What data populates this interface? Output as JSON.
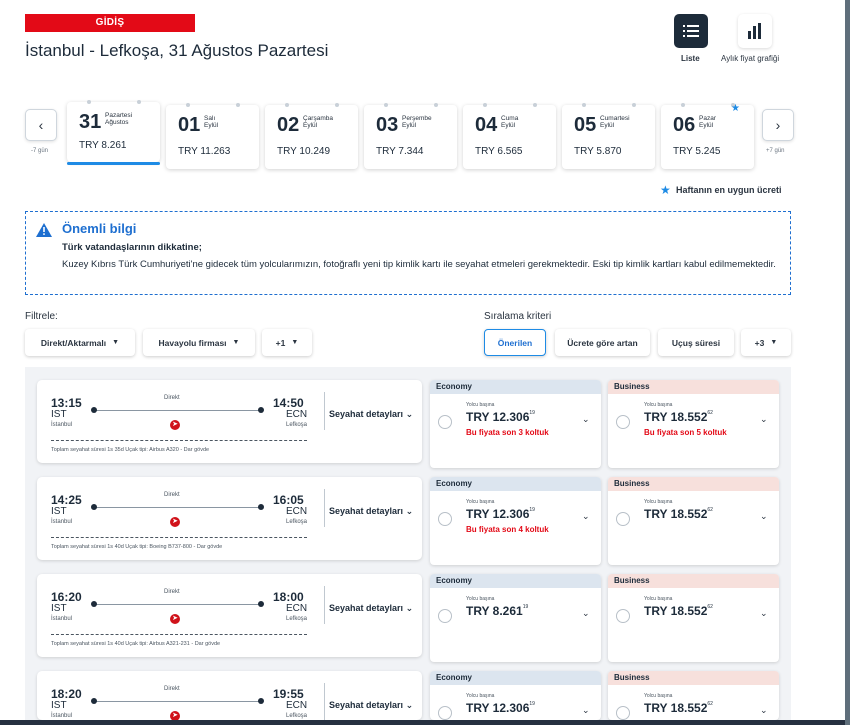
{
  "header": {
    "badge": "GİDİŞ",
    "route": "İstanbul - Lefkoşa, 31 Ağustos Pazartesi"
  },
  "views": {
    "list": "Liste",
    "chart": "Aylık fiyat grafiği"
  },
  "datebar": {
    "prev_label": "-7 gün",
    "next_label": "+7 gün",
    "prev_icon": "chevron-left-icon",
    "next_icon": "chevron-right-icon",
    "dates": [
      {
        "day": "31",
        "weekday": "Pazartesi",
        "month": "Ağustos",
        "price": "TRY 8.261"
      },
      {
        "day": "01",
        "weekday": "Salı",
        "month": "Eylül",
        "price": "TRY 11.263"
      },
      {
        "day": "02",
        "weekday": "Çarşamba",
        "month": "Eylül",
        "price": "TRY 10.249"
      },
      {
        "day": "03",
        "weekday": "Perşembe",
        "month": "Eylül",
        "price": "TRY 7.344"
      },
      {
        "day": "04",
        "weekday": "Cuma",
        "month": "Eylül",
        "price": "TRY 6.565"
      },
      {
        "day": "05",
        "weekday": "Cumartesi",
        "month": "Eylül",
        "price": "TRY 5.870"
      },
      {
        "day": "06",
        "weekday": "Pazar",
        "month": "Eylül",
        "price": "TRY 5.245"
      }
    ],
    "best_note": "Haftanın en uygun ücreti"
  },
  "info": {
    "title": "Önemli bilgi",
    "line1": "Türk vatandaşlarının dikkatine;",
    "line2": "Kuzey Kıbrıs Türk Cumhuriyeti'ne gidecek tüm yolcularımızın, fotoğraflı yeni tip kimlik kartı ile seyahat etmeleri gerekmektedir. Eski tip kimlik kartları kabul edilmemektedir."
  },
  "filters": {
    "label": "Filtrele:",
    "f1": "Direkt/Aktarmalı",
    "f2": "Havayolu firması",
    "f3": "+1"
  },
  "sort": {
    "label": "Sıralama kriteri",
    "s1": "Önerilen",
    "s2": "Ücrete göre artan",
    "s3": "Uçuş süresi",
    "s4": "+3"
  },
  "common": {
    "direct": "Direkt",
    "details": "Seyahat detayları",
    "per_pax": "Yolcu başına",
    "economy": "Economy",
    "business": "Business"
  },
  "flights": [
    {
      "dep": "13:15",
      "arr": "14:50",
      "from": "IST",
      "to": "ECN",
      "from_city": "İstanbul",
      "to_city": "Lefkoşa",
      "meta": "Toplam seyahat süresi 1s 35d  Uçak tipi: Airbus A320 - Dar gövde",
      "eco_int": "TRY 12.306",
      "eco_dec": "19",
      "eco_warn": "Bu fiyata son 3 koltuk",
      "bus_int": "TRY 18.552",
      "bus_dec": "62",
      "bus_warn": "Bu fiyata son 5 koltuk"
    },
    {
      "dep": "14:25",
      "arr": "16:05",
      "from": "IST",
      "to": "ECN",
      "from_city": "İstanbul",
      "to_city": "Lefkoşa",
      "meta": "Toplam seyahat süresi 1s 40d  Uçak tipi: Boeing B737-800 - Dar gövde",
      "eco_int": "TRY 12.306",
      "eco_dec": "19",
      "eco_warn": "Bu fiyata son 4 koltuk",
      "bus_int": "TRY 18.552",
      "bus_dec": "62",
      "bus_warn": ""
    },
    {
      "dep": "16:20",
      "arr": "18:00",
      "from": "IST",
      "to": "ECN",
      "from_city": "İstanbul",
      "to_city": "Lefkoşa",
      "meta": "Toplam seyahat süresi 1s 40d  Uçak tipi: Airbus A321-231 - Dar gövde",
      "eco_int": "TRY 8.261",
      "eco_dec": "19",
      "eco_warn": "",
      "bus_int": "TRY 18.552",
      "bus_dec": "62",
      "bus_warn": ""
    },
    {
      "dep": "18:20",
      "arr": "19:55",
      "from": "IST",
      "to": "ECN",
      "from_city": "İstanbul",
      "to_city": "Lefkoşa",
      "meta": "",
      "eco_int": "TRY 12.306",
      "eco_dec": "19",
      "eco_warn": "",
      "bus_int": "TRY 18.552",
      "bus_dec": "62",
      "bus_warn": ""
    }
  ],
  "colors": {
    "brand_red": "#e30a17",
    "accent_blue": "#1e8be5",
    "info_blue": "#1e6fd0"
  }
}
